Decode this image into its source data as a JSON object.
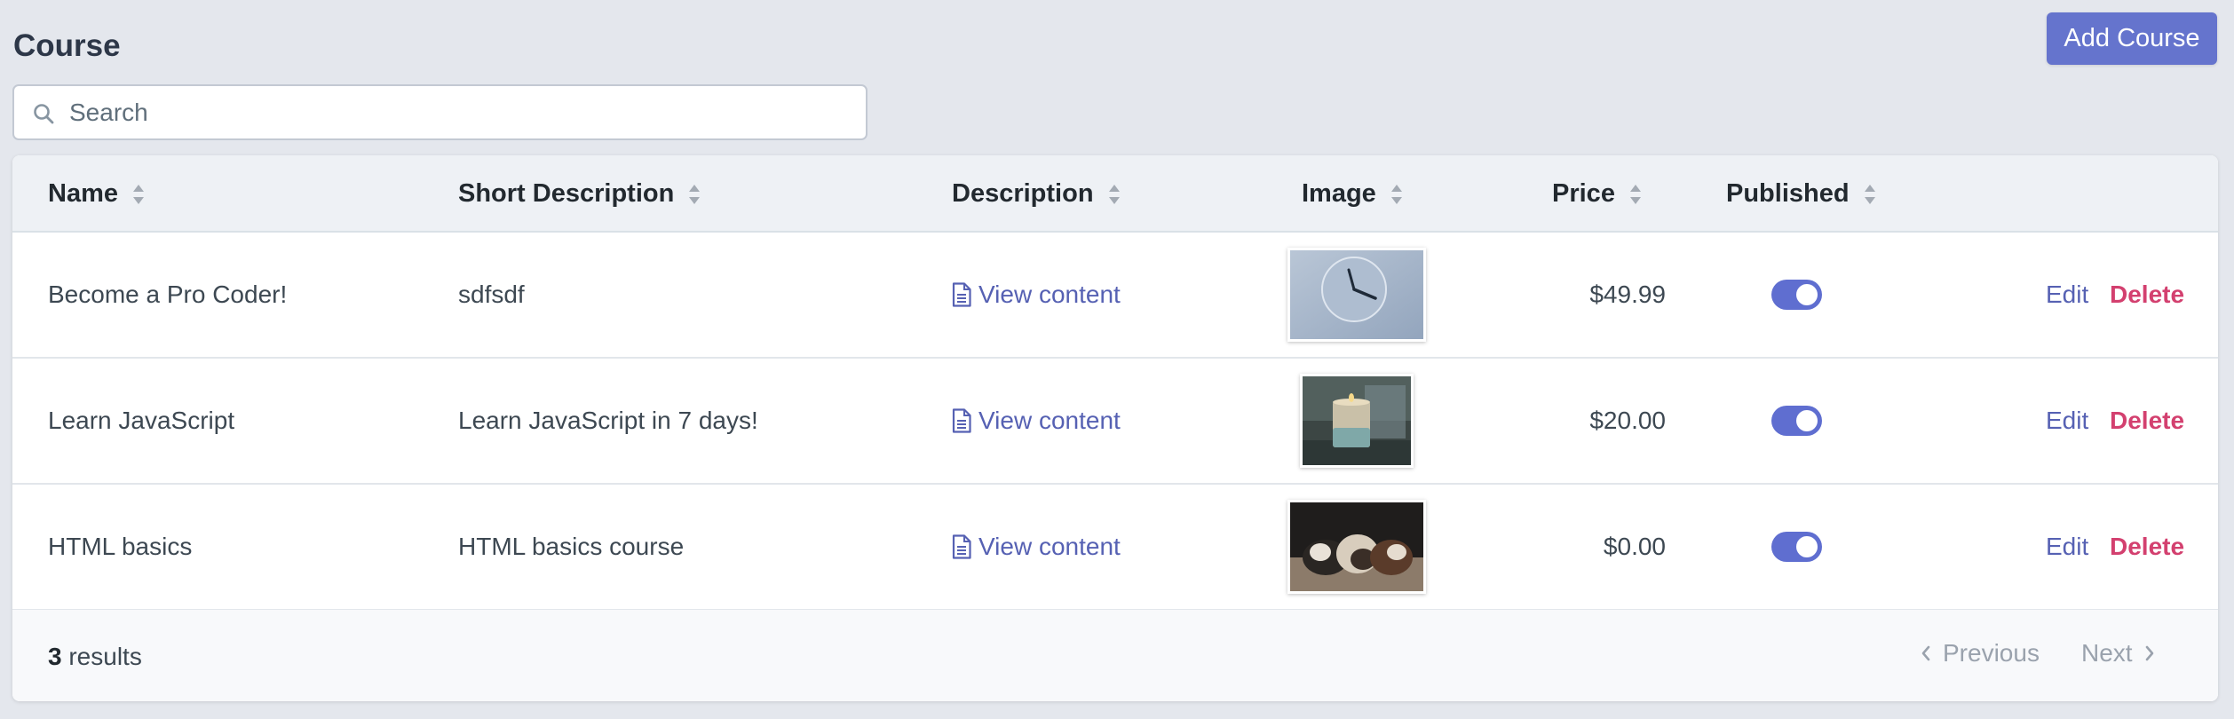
{
  "header": {
    "title": "Course",
    "add_button_label": "Add Course"
  },
  "search": {
    "placeholder": "Search",
    "value": ""
  },
  "table": {
    "columns": [
      "Name",
      "Short Description",
      "Description",
      "Image",
      "Price",
      "Published"
    ],
    "rows": [
      {
        "name": "Become a Pro Coder!",
        "short_description": "sdfsdf",
        "description_link": "View content",
        "image": "clock-photo",
        "price": "$49.99",
        "published": true,
        "edit_label": "Edit",
        "delete_label": "Delete"
      },
      {
        "name": "Learn JavaScript",
        "short_description": "Learn JavaScript in 7 days!",
        "description_link": "View content",
        "image": "candle-photo",
        "price": "$20.00",
        "published": true,
        "edit_label": "Edit",
        "delete_label": "Delete"
      },
      {
        "name": "HTML basics",
        "short_description": "HTML basics course",
        "description_link": "View content",
        "image": "guinea-pigs-photo",
        "price": "$0.00",
        "published": true,
        "edit_label": "Edit",
        "delete_label": "Delete"
      }
    ]
  },
  "footer": {
    "results_count": "3",
    "results_label": "results",
    "previous_label": "Previous",
    "next_label": "Next"
  },
  "colors": {
    "accent": "#6574cd",
    "link": "#5661b3",
    "danger": "#cc1f56",
    "background": "#e4e7ed"
  },
  "icons": [
    "search-icon",
    "sort-icon",
    "document-icon",
    "chevron-left-icon",
    "chevron-right-icon"
  ]
}
